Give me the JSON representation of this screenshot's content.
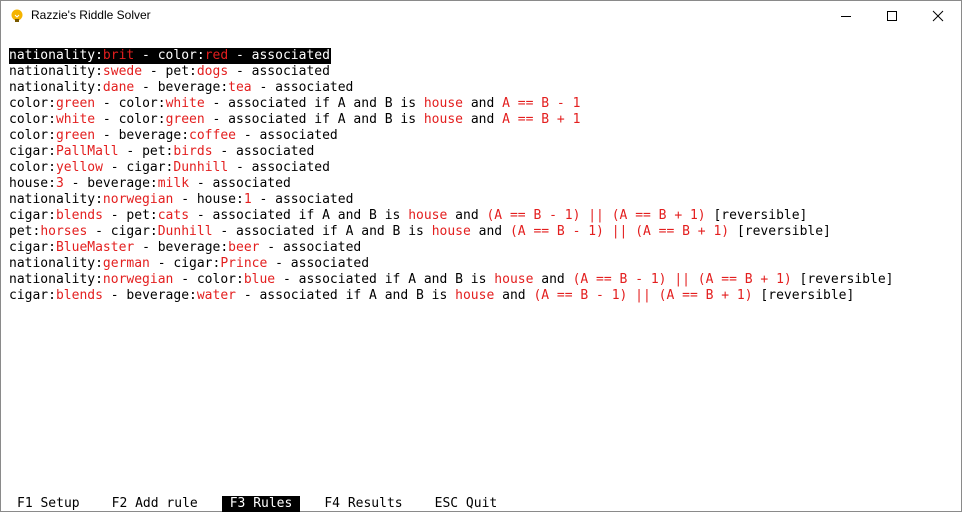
{
  "window": {
    "title": "Razzie's Riddle Solver",
    "icon": "lightbulb-icon",
    "controls": [
      "minimize-icon",
      "maximize-icon",
      "close-icon"
    ]
  },
  "colors": {
    "value": "#e31e1e",
    "text": "#000000",
    "selection_bg": "#000000"
  },
  "rules": [
    [
      {
        "t": "nationality:"
      },
      {
        "t": "brit",
        "v": true
      },
      {
        "t": " - color:"
      },
      {
        "t": "red",
        "v": true
      },
      {
        "t": " - associated"
      }
    ],
    [
      {
        "t": "nationality:"
      },
      {
        "t": "swede",
        "v": true
      },
      {
        "t": " - pet:"
      },
      {
        "t": "dogs",
        "v": true
      },
      {
        "t": " - associated"
      }
    ],
    [
      {
        "t": "nationality:"
      },
      {
        "t": "dane",
        "v": true
      },
      {
        "t": " - beverage:"
      },
      {
        "t": "tea",
        "v": true
      },
      {
        "t": " - associated"
      }
    ],
    [
      {
        "t": "color:"
      },
      {
        "t": "green",
        "v": true
      },
      {
        "t": " - color:"
      },
      {
        "t": "white",
        "v": true
      },
      {
        "t": " - associated if A and B is "
      },
      {
        "t": "house",
        "v": true
      },
      {
        "t": " and "
      },
      {
        "t": "A == B - 1",
        "v": true
      }
    ],
    [
      {
        "t": "color:"
      },
      {
        "t": "white",
        "v": true
      },
      {
        "t": " - color:"
      },
      {
        "t": "green",
        "v": true
      },
      {
        "t": " - associated if A and B is "
      },
      {
        "t": "house",
        "v": true
      },
      {
        "t": " and "
      },
      {
        "t": "A == B + 1",
        "v": true
      }
    ],
    [
      {
        "t": "color:"
      },
      {
        "t": "green",
        "v": true
      },
      {
        "t": " - beverage:"
      },
      {
        "t": "coffee",
        "v": true
      },
      {
        "t": " - associated"
      }
    ],
    [
      {
        "t": "cigar:"
      },
      {
        "t": "PallMall",
        "v": true
      },
      {
        "t": " - pet:"
      },
      {
        "t": "birds",
        "v": true
      },
      {
        "t": " - associated"
      }
    ],
    [
      {
        "t": "color:"
      },
      {
        "t": "yellow",
        "v": true
      },
      {
        "t": " - cigar:"
      },
      {
        "t": "Dunhill",
        "v": true
      },
      {
        "t": " - associated"
      }
    ],
    [
      {
        "t": "house:"
      },
      {
        "t": "3",
        "v": true
      },
      {
        "t": " - beverage:"
      },
      {
        "t": "milk",
        "v": true
      },
      {
        "t": " - associated"
      }
    ],
    [
      {
        "t": "nationality:"
      },
      {
        "t": "norwegian",
        "v": true
      },
      {
        "t": " - house:"
      },
      {
        "t": "1",
        "v": true
      },
      {
        "t": " - associated"
      }
    ],
    [
      {
        "t": "cigar:"
      },
      {
        "t": "blends",
        "v": true
      },
      {
        "t": " - pet:"
      },
      {
        "t": "cats",
        "v": true
      },
      {
        "t": " - associated if A and B is "
      },
      {
        "t": "house",
        "v": true
      },
      {
        "t": " and "
      },
      {
        "t": "(A == B - 1) || (A == B + 1)",
        "v": true
      },
      {
        "t": " [reversible]"
      }
    ],
    [
      {
        "t": "pet:"
      },
      {
        "t": "horses",
        "v": true
      },
      {
        "t": " - cigar:"
      },
      {
        "t": "Dunhill",
        "v": true
      },
      {
        "t": " - associated if A and B is "
      },
      {
        "t": "house",
        "v": true
      },
      {
        "t": " and "
      },
      {
        "t": "(A == B - 1) || (A == B + 1)",
        "v": true
      },
      {
        "t": " [reversible]"
      }
    ],
    [
      {
        "t": "cigar:"
      },
      {
        "t": "BlueMaster",
        "v": true
      },
      {
        "t": " - beverage:"
      },
      {
        "t": "beer",
        "v": true
      },
      {
        "t": " - associated"
      }
    ],
    [
      {
        "t": "nationality:"
      },
      {
        "t": "german",
        "v": true
      },
      {
        "t": " - cigar:"
      },
      {
        "t": "Prince",
        "v": true
      },
      {
        "t": " - associated"
      }
    ],
    [
      {
        "t": "nationality:"
      },
      {
        "t": "norwegian",
        "v": true
      },
      {
        "t": " - color:"
      },
      {
        "t": "blue",
        "v": true
      },
      {
        "t": " - associated if A and B is "
      },
      {
        "t": "house",
        "v": true
      },
      {
        "t": " and "
      },
      {
        "t": "(A == B - 1) || (A == B + 1)",
        "v": true
      },
      {
        "t": " [reversible]"
      }
    ],
    [
      {
        "t": "cigar:"
      },
      {
        "t": "blends",
        "v": true
      },
      {
        "t": " - beverage:"
      },
      {
        "t": "water",
        "v": true
      },
      {
        "t": " - associated if A and B is "
      },
      {
        "t": "house",
        "v": true
      },
      {
        "t": " and "
      },
      {
        "t": "(A == B - 1) || (A == B + 1)",
        "v": true
      },
      {
        "t": " [reversible]"
      }
    ]
  ],
  "selected_rule": 0,
  "footer": {
    "items": [
      {
        "label": "F1 Setup",
        "active": false
      },
      {
        "label": "F2 Add rule",
        "active": false
      },
      {
        "label": "F3 Rules",
        "active": true
      },
      {
        "label": "F4 Results",
        "active": false
      },
      {
        "label": "ESC Quit",
        "active": false
      }
    ]
  }
}
